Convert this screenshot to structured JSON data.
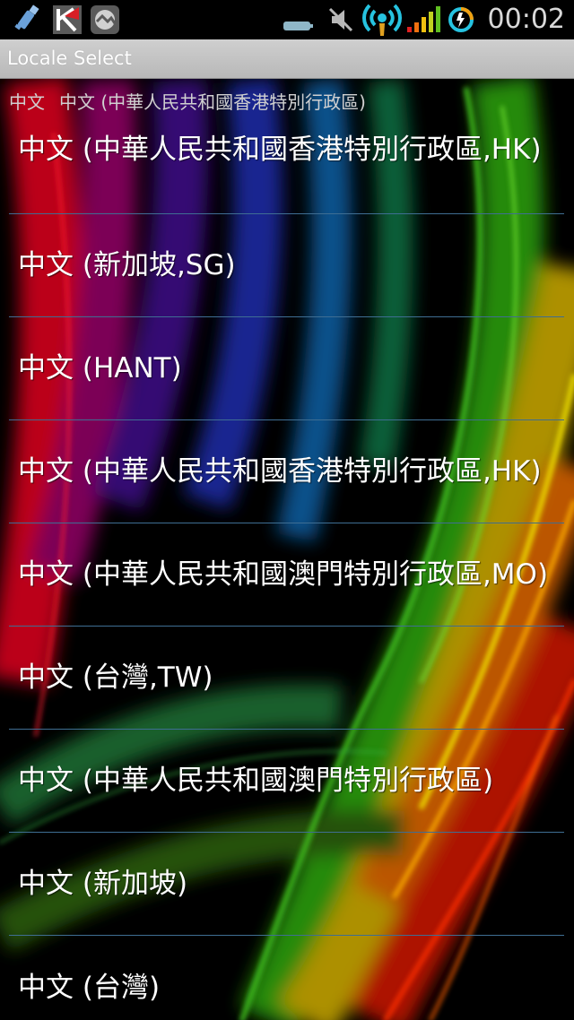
{
  "status_bar": {
    "time": "00:02",
    "icons": [
      "usb-debug-icon",
      "kaspersky-icon",
      "photo-app-icon",
      "battery-small-icon",
      "mute-icon",
      "wifi-tether-icon",
      "signal-bars-icon",
      "battery-ring-icon"
    ]
  },
  "app": {
    "title": "Locale Select"
  },
  "current_locale": {
    "language": "中文",
    "display": "中文 (中華人民共和國香港特別行政區)"
  },
  "locales": [
    {
      "label": "中文 (中華人民共和國香港特別行政區,HK)"
    },
    {
      "label": "中文 (新加坡,SG)"
    },
    {
      "label": "中文 (HANT)"
    },
    {
      "label": "中文 (中華人民共和國香港特別行政區,HK)"
    },
    {
      "label": "中文 (中華人民共和國澳門特別行政區,MO)"
    },
    {
      "label": "中文 (台灣,TW)"
    },
    {
      "label": "中文 (中華人民共和國澳門特別行政區)"
    },
    {
      "label": "中文 (新加坡)"
    },
    {
      "label": "中文 (台灣)"
    }
  ],
  "colors": {
    "divider": "#3f6e93",
    "title_bar": "#c4c4c4",
    "list_text": "#ffffff"
  }
}
